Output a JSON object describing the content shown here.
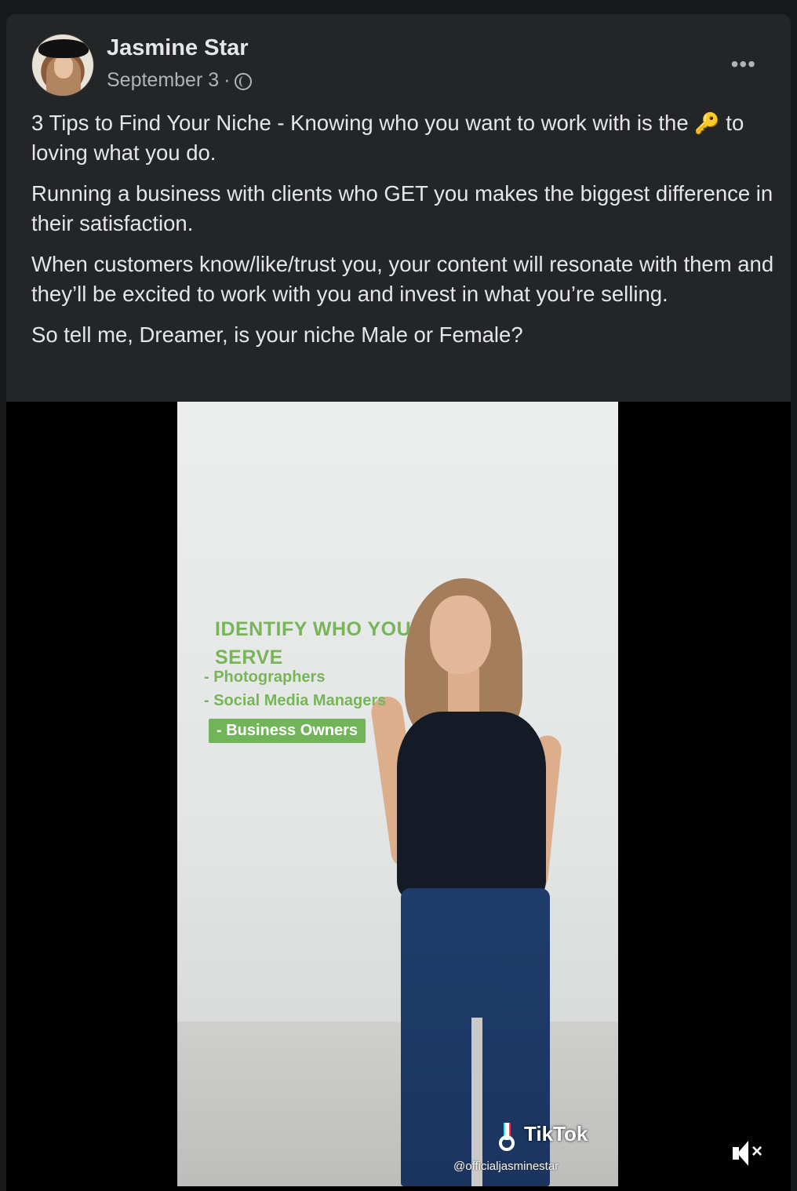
{
  "post": {
    "author": "Jasmine Star",
    "date": "September 3",
    "separator": "·",
    "privacy_icon": "globe-icon",
    "more_icon": "more-options-icon",
    "paragraphs": {
      "p1_before_icon": "3 Tips to Find Your Niche - Knowing who you want to work with is the ",
      "p1_icon": "🔑",
      "p1_after_icon": " to loving what you do.",
      "p2": "Running a business with clients who GET you makes the biggest difference in their satisfaction.",
      "p3": "When customers know/like/trust you, your content will resonate with them and they’ll be excited to work with you and invest in what you’re selling.",
      "p4": "So tell me, Dreamer, is your niche Male or Female?"
    }
  },
  "video": {
    "overlay_title": "IDENTIFY WHO YOU SERVE",
    "overlay_items": [
      "- Photographers",
      "- Social Media Managers",
      "- Business Owners"
    ],
    "tiktok_brand": "TikTok",
    "tiktok_handle": "@officialjasminestar",
    "mute_icon": "muted-speaker-icon",
    "accent_color": "#77b558"
  }
}
